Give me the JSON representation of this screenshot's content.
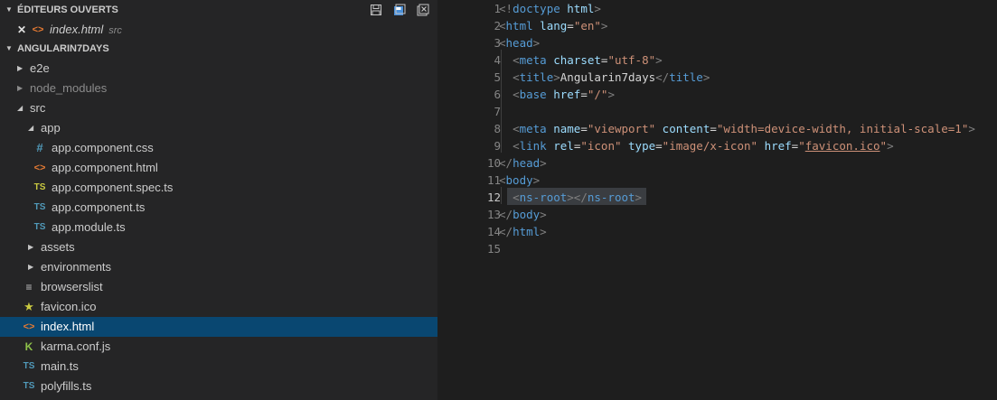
{
  "explorer": {
    "open_editors": {
      "title": "ÉDITEURS OUVERTS",
      "items": [
        {
          "name": "index.html",
          "desc": "src"
        }
      ]
    },
    "project": {
      "title": "ANGULARIN7DAYS",
      "items": [
        {
          "label": "e2e"
        },
        {
          "label": "node_modules"
        },
        {
          "label": "src"
        },
        {
          "label": "app"
        },
        {
          "label": "app.component.css",
          "icon_text": "#"
        },
        {
          "label": "app.component.html",
          "icon_text": "<>"
        },
        {
          "label": "app.component.spec.ts",
          "icon_text": "TS"
        },
        {
          "label": "app.component.ts",
          "icon_text": "TS"
        },
        {
          "label": "app.module.ts",
          "icon_text": "TS"
        },
        {
          "label": "assets"
        },
        {
          "label": "environments"
        },
        {
          "label": "browserslist",
          "icon_text": "≡"
        },
        {
          "label": "favicon.ico",
          "icon_text": "★"
        },
        {
          "label": "index.html",
          "icon_text": "<>"
        },
        {
          "label": "karma.conf.js",
          "icon_text": "K"
        },
        {
          "label": "main.ts",
          "icon_text": "TS"
        },
        {
          "label": "polyfills.ts",
          "icon_text": "TS"
        }
      ]
    }
  },
  "editor": {
    "line_numbers": [
      "1",
      "2",
      "3",
      "4",
      "5",
      "6",
      "7",
      "8",
      "9",
      "10",
      "11",
      "12",
      "13",
      "14",
      "15"
    ],
    "lines": [
      [
        "<!",
        "doctype",
        " ",
        "html",
        ">"
      ],
      [
        "<",
        "html",
        " ",
        "lang",
        "=",
        "\"en\"",
        ">"
      ],
      [
        "<",
        "head",
        ">"
      ],
      [
        "  ",
        "<",
        "meta",
        " ",
        "charset",
        "=",
        "\"utf-8\"",
        ">"
      ],
      [
        "  ",
        "<",
        "title",
        ">",
        "Angularin7days",
        "</",
        "title",
        ">"
      ],
      [
        "  ",
        "<",
        "base",
        " ",
        "href",
        "=",
        "\"/\"",
        ">"
      ],
      [
        ""
      ],
      [
        "  ",
        "<",
        "meta",
        " ",
        "name",
        "=",
        "\"viewport\"",
        " ",
        "content",
        "=",
        "\"width=device-width, initial-scale=1\"",
        ">"
      ],
      [
        "  ",
        "<",
        "link",
        " ",
        "rel",
        "=",
        "\"icon\"",
        " ",
        "type",
        "=",
        "\"image/x-icon\"",
        " ",
        "href",
        "=",
        "\"",
        "favicon.ico",
        "\"",
        ">"
      ],
      [
        "</",
        "head",
        ">"
      ],
      [
        "<",
        "body",
        ">"
      ],
      [
        "  ",
        "<",
        "ns-root",
        "></",
        "ns-root",
        ">"
      ],
      [
        "</",
        "body",
        ">"
      ],
      [
        "</",
        "html",
        ">"
      ],
      [
        ""
      ]
    ],
    "colors": {
      "tag": "#569cd6",
      "punct": "#808080",
      "attr": "#9cdcfe",
      "string": "#ce9178",
      "text": "#d4d4d4",
      "selection_bg": "#094771"
    }
  }
}
